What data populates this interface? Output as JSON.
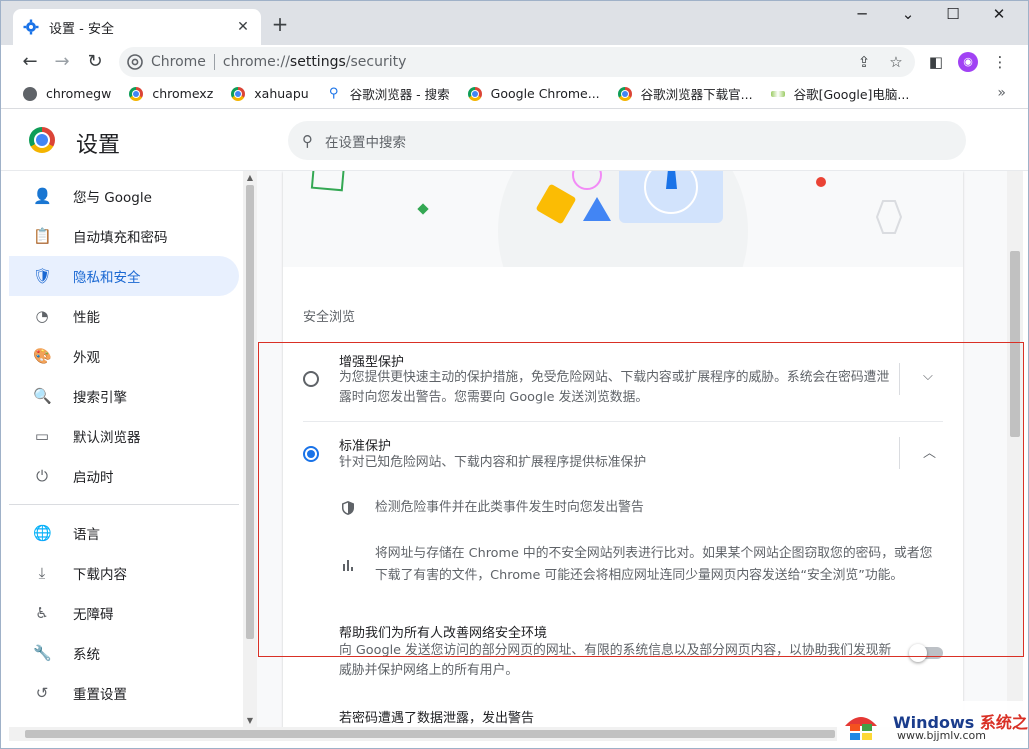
{
  "tab": {
    "title": "设置 - 安全",
    "close": "✕",
    "new": "+"
  },
  "window": {
    "minimize": "─",
    "maximize": "☐",
    "close": "✕"
  },
  "toolbar": {
    "back": "←",
    "forward": "→",
    "reload": "↻",
    "site_label": "Chrome",
    "url_prefix": "chrome://",
    "url_host": "settings",
    "url_path": "/security",
    "avatar": "◉"
  },
  "bookmarks": [
    {
      "label": "chromegw",
      "icon": "globe"
    },
    {
      "label": "chromexz",
      "icon": "chrome"
    },
    {
      "label": "xahuapu",
      "icon": "chrome"
    },
    {
      "label": "谷歌浏览器 - 搜索",
      "icon": "search"
    },
    {
      "label": "Google Chrome...",
      "icon": "chrome"
    },
    {
      "label": "谷歌浏览器下载官...",
      "icon": "chrome"
    },
    {
      "label": "谷歌[Google]电脑...",
      "icon": "flag"
    }
  ],
  "bookmarks_more": "»",
  "settings": {
    "title": "设置",
    "search_placeholder": "在设置中搜索"
  },
  "sidebar": {
    "items": [
      {
        "label": "您与 Google",
        "icon": "person-icon",
        "glyph": "👤"
      },
      {
        "label": "自动填充和密码",
        "icon": "clipboard-icon",
        "glyph": "📋"
      },
      {
        "label": "隐私和安全",
        "icon": "shield-icon",
        "glyph": "🛡",
        "active": true
      },
      {
        "label": "性能",
        "icon": "speedometer-icon",
        "glyph": "◔"
      },
      {
        "label": "外观",
        "icon": "palette-icon",
        "glyph": "🎨"
      },
      {
        "label": "搜索引擎",
        "icon": "search-icon",
        "glyph": "🔍"
      },
      {
        "label": "默认浏览器",
        "icon": "browser-icon",
        "glyph": "▭"
      },
      {
        "label": "启动时",
        "icon": "power-icon",
        "glyph": "⏻"
      },
      {
        "label": "语言",
        "icon": "globe-icon",
        "glyph": "🌐"
      },
      {
        "label": "下载内容",
        "icon": "download-icon",
        "glyph": "⤓"
      },
      {
        "label": "无障碍",
        "icon": "accessibility-icon",
        "glyph": "♿"
      },
      {
        "label": "系统",
        "icon": "wrench-icon",
        "glyph": "🔧"
      },
      {
        "label": "重置设置",
        "icon": "reset-icon",
        "glyph": "↺"
      }
    ]
  },
  "security": {
    "section_heading": "安全浏览",
    "enhanced": {
      "title": "增强型保护",
      "desc": "为您提供更快速主动的保护措施，免受危险网站、下载内容或扩展程序的威胁。系统会在密码遭泄露时向您发出警告。您需要向 Google 发送浏览数据。",
      "selected": false
    },
    "standard": {
      "title": "标准保护",
      "desc": "针对已知危险网站、下载内容和扩展程序提供标准保护",
      "selected": true,
      "details": [
        "检测危险事件并在此类事件发生时向您发出警告",
        "将网址与存储在 Chrome 中的不安全网站列表进行比对。如果某个网站企图窃取您的密码，或者您下载了有害的文件，Chrome 可能还会将相应网址连同少量网页内容发送给“安全浏览”功能。"
      ]
    },
    "help_improve": {
      "title": "帮助我们为所有人改善网络安全环境",
      "desc": "向 Google 发送您访问的部分网页的网址、有限的系统信息以及部分网页内容，以协助我们发现新威胁并保护网络上的所有用户。",
      "enabled": false
    },
    "password_warn": {
      "title": "若密码遭遇了数据泄露，发出警告"
    }
  },
  "watermark": {
    "brand": "Windows",
    "brand_cn": "系统之家",
    "url": "www.bjjmlv.com"
  },
  "colors": {
    "accent": "#1a73e8",
    "active_bg": "#e8f0fe",
    "highlight_box": "#d93025"
  }
}
